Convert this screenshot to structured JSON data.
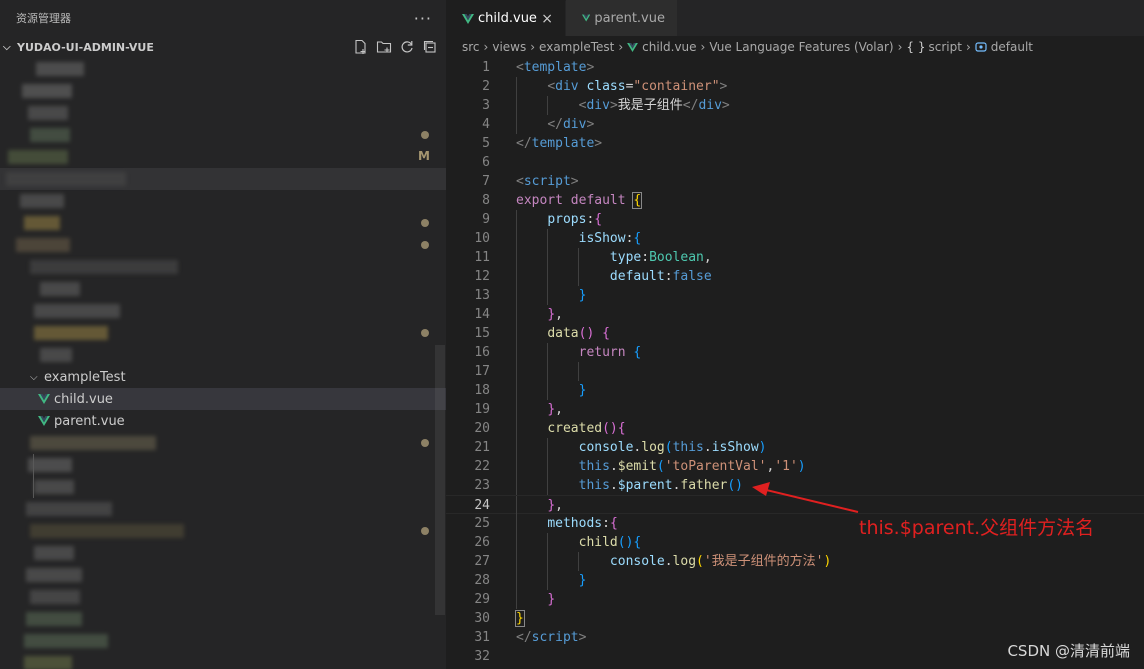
{
  "sidebar": {
    "title": "资源管理器",
    "more": "···",
    "project": "YUDAO-UI-ADMIN-VUE",
    "modified_marker": "M",
    "folder": "exampleTest",
    "files": [
      "child.vue",
      "parent.vue"
    ]
  },
  "tabs": [
    {
      "label": "child.vue",
      "close": "×"
    },
    {
      "label": "parent.vue"
    }
  ],
  "breadcrumb": {
    "parts": [
      "src",
      "views",
      "exampleTest",
      "child.vue",
      "Vue Language Features (Volar)"
    ],
    "script_icon": "{ }",
    "script": "script",
    "default": "default"
  },
  "line_numbers": [
    "1",
    "2",
    "3",
    "4",
    "5",
    "6",
    "7",
    "8",
    "9",
    "10",
    "11",
    "12",
    "13",
    "14",
    "15",
    "16",
    "17",
    "18",
    "19",
    "20",
    "21",
    "22",
    "23",
    "24",
    "25",
    "26",
    "27",
    "28",
    "29",
    "30",
    "31",
    "32"
  ],
  "current_line": 24,
  "annotation": "this.$parent.父组件方法名",
  "watermark": "CSDN @清清前端",
  "colors": {
    "annotation": "#e02020",
    "vue_green": "#41b883",
    "vue_dark": "#35495e"
  }
}
